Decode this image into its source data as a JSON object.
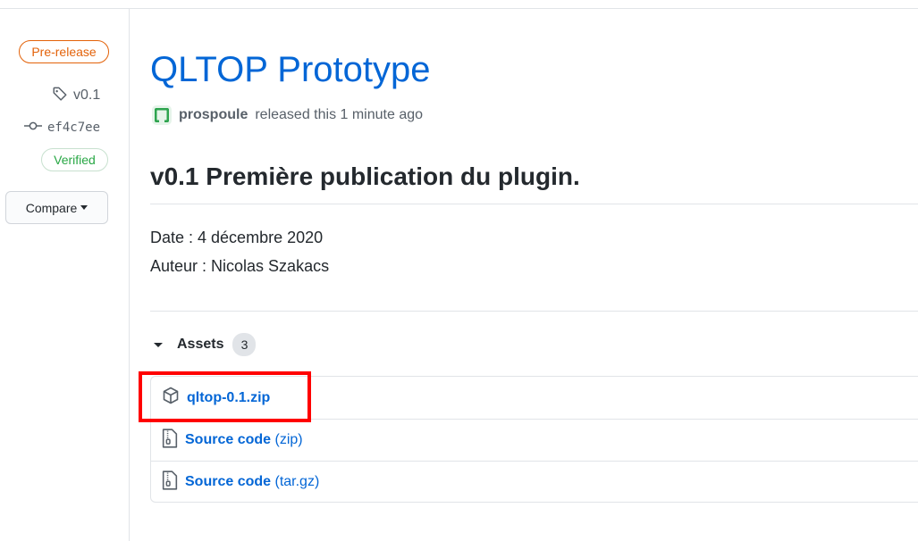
{
  "sidebar": {
    "prerelease_label": "Pre-release",
    "tag": "v0.1",
    "commit": "ef4c7ee",
    "verified_label": "Verified",
    "compare_label": "Compare"
  },
  "release": {
    "title": "QLTOP Prototype",
    "author": "prospoule",
    "released_text": "released this 1 minute ago",
    "heading": "v0.1 Première publication du plugin.",
    "body": [
      "Date : 4 décembre 2020",
      "Auteur : Nicolas Szakacs"
    ]
  },
  "assets": {
    "label": "Assets",
    "count": "3",
    "items": [
      {
        "name": "qltop-0.1.zip",
        "suffix": "",
        "icon": "package-icon"
      },
      {
        "name": "Source code",
        "suffix": "(zip)",
        "icon": "file-zip-icon"
      },
      {
        "name": "Source code",
        "suffix": "(tar.gz)",
        "icon": "file-zip-icon"
      }
    ]
  },
  "colors": {
    "link": "#0366d6",
    "prerelease": "#e36209",
    "verified": "#28a745",
    "highlight": "#ff0000"
  }
}
